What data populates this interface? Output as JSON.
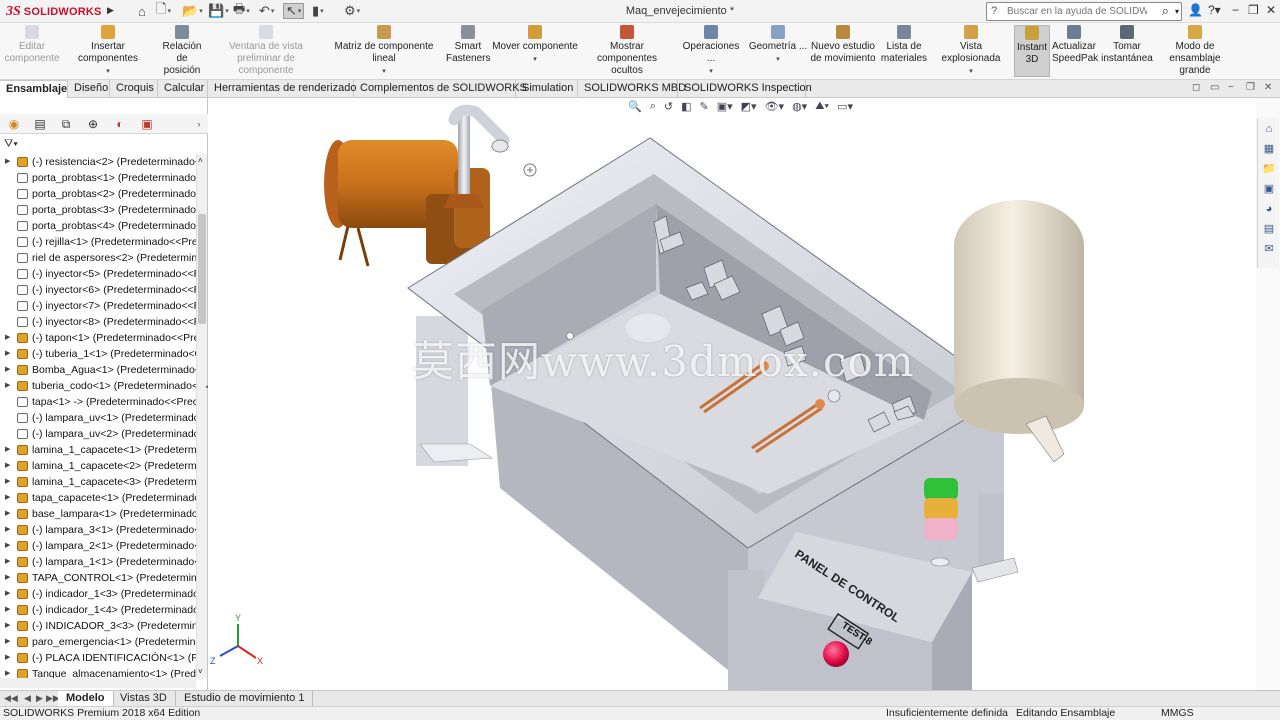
{
  "app": {
    "logo_ds": "3S",
    "logo_text": "SOLIDWORKS",
    "document_title": "Maq_envejecimiento *",
    "help_search_placeholder": "Buscar en la ayuda de SOLIDWORKS"
  },
  "quick_access": [
    "home-icon",
    "new-file-icon",
    "open-folder-icon",
    "save-icon",
    "print-icon",
    "undo-icon",
    "select-arrow-icon",
    "traffic-light-icon",
    "options-icon"
  ],
  "ribbon": [
    {
      "id": "editar",
      "label1": "Editar",
      "label2": "componente",
      "disabled": true
    },
    {
      "id": "insertar",
      "label1": "Insertar componentes",
      "label2": "",
      "disabled": false,
      "dropdown": true
    },
    {
      "id": "relacion",
      "label1": "Relación de",
      "label2": "posición",
      "disabled": false
    },
    {
      "id": "ventana",
      "label1": "Ventana de vista",
      "label2": "preliminar de componente",
      "disabled": true
    },
    {
      "id": "matriz",
      "label1": "Matriz de componente lineal",
      "label2": "",
      "disabled": false,
      "dropdown": true
    },
    {
      "id": "smart",
      "label1": "Smart",
      "label2": "Fasteners",
      "disabled": false
    },
    {
      "id": "mover",
      "label1": "Mover componente",
      "label2": "",
      "disabled": false,
      "dropdown": true
    },
    {
      "id": "mostrar",
      "label1": "Mostrar",
      "label2": "componentes ocultos",
      "disabled": false
    },
    {
      "id": "operaciones",
      "label1": "Operaciones ...",
      "label2": "",
      "disabled": false,
      "dropdown": true
    },
    {
      "id": "geometria",
      "label1": "Geometría ...",
      "label2": "",
      "disabled": false,
      "dropdown": true
    },
    {
      "id": "estudio",
      "label1": "Nuevo estudio",
      "label2": "de movimiento",
      "disabled": false
    },
    {
      "id": "lista",
      "label1": "Lista de",
      "label2": "materiales",
      "disabled": false
    },
    {
      "id": "explosionada",
      "label1": "Vista explosionada",
      "label2": "",
      "disabled": false,
      "dropdown": true
    },
    {
      "id": "instant3d",
      "label1": "Instant",
      "label2": "3D",
      "disabled": false,
      "active": true
    },
    {
      "id": "speedpak",
      "label1": "Actualizar",
      "label2": "SpeedPak",
      "disabled": false
    },
    {
      "id": "instantanea",
      "label1": "Tomar",
      "label2": "instantánea",
      "disabled": false
    },
    {
      "id": "grande",
      "label1": "Modo de",
      "label2": "ensamblaje grande",
      "disabled": false
    }
  ],
  "command_tabs": [
    "Ensamblaje",
    "Diseño",
    "Croquis",
    "Calcular",
    "Herramientas de renderizado",
    "Complementos de SOLIDWORKS",
    "Simulation",
    "SOLIDWORKS MBD",
    "SOLIDWORKS Inspection"
  ],
  "feature_tree": [
    {
      "label": "(-) resistencia<2> (Predeterminado<",
      "type": "asm",
      "expand": true
    },
    {
      "label": "porta_probtas<1> (Predeterminado-",
      "type": "part",
      "expand": false
    },
    {
      "label": "porta_probtas<2> (Predeterminado-",
      "type": "part",
      "expand": false
    },
    {
      "label": "porta_probtas<3> (Predeterminado-",
      "type": "part",
      "expand": false
    },
    {
      "label": "porta_probtas<4> (Predeterminado-",
      "type": "part",
      "expand": false
    },
    {
      "label": "(-) rejilla<1> (Predeterminado<<Pre",
      "type": "part",
      "expand": false
    },
    {
      "label": "riel de aspersores<2> (Predetermina",
      "type": "part",
      "expand": false
    },
    {
      "label": "(-) inyector<5> (Predeterminado<<P",
      "type": "part",
      "expand": false
    },
    {
      "label": "(-) inyector<6> (Predeterminado<<P",
      "type": "part",
      "expand": false
    },
    {
      "label": "(-) inyector<7> (Predeterminado<<P",
      "type": "part",
      "expand": false
    },
    {
      "label": "(-) inyector<8> (Predeterminado<<P",
      "type": "part",
      "expand": false
    },
    {
      "label": "(-) tapon<1> (Predeterminado<<Pre",
      "type": "asm",
      "expand": true
    },
    {
      "label": "(-) tuberia_1<1> (Predeterminado<C",
      "type": "asm",
      "expand": true
    },
    {
      "label": "Bomba_Agua<1> (Predeterminado<",
      "type": "asm",
      "expand": true
    },
    {
      "label": "tuberia_codo<1> (Predeterminado<",
      "type": "asm",
      "expand": true
    },
    {
      "label": "tapa<1> -> (Predeterminado<<Prec",
      "type": "part",
      "expand": false
    },
    {
      "label": "(-) lampara_uv<1> (Predeterminado",
      "type": "part",
      "expand": false
    },
    {
      "label": "(-) lampara_uv<2> (Predeterminado",
      "type": "part",
      "expand": false
    },
    {
      "label": "lamina_1_capacete<1> (Predetermin",
      "type": "asm",
      "expand": true
    },
    {
      "label": "lamina_1_capacete<2> (Predetermin",
      "type": "asm",
      "expand": true
    },
    {
      "label": "lamina_1_capacete<3> (Predetermin",
      "type": "asm",
      "expand": true
    },
    {
      "label": "tapa_capacete<1> (Predeterminado",
      "type": "asm",
      "expand": true
    },
    {
      "label": "base_lampara<1> (Predeterminado-",
      "type": "asm",
      "expand": true
    },
    {
      "label": "(-) lampara_3<1> (Predeterminado<",
      "type": "asm",
      "expand": true
    },
    {
      "label": "(-) lampara_2<1> (Predeterminado<",
      "type": "asm",
      "expand": true
    },
    {
      "label": "(-) lampara_1<1> (Predeterminado<",
      "type": "asm",
      "expand": true
    },
    {
      "label": "TAPA_CONTROL<1> (Predeterminad",
      "type": "asm",
      "expand": true
    },
    {
      "label": "(-) indicador_1<3> (Predeterminado",
      "type": "asm",
      "expand": true
    },
    {
      "label": "(-) indicador_1<4> (Predeterminado",
      "type": "asm",
      "expand": true
    },
    {
      "label": "(-) INDICADOR_3<3> (Predetermina",
      "type": "asm",
      "expand": true
    },
    {
      "label": "paro_emergencia<1> (Predetermina",
      "type": "asm",
      "expand": true
    },
    {
      "label": "(-) PLACA IDENTIFICACIÓN<1> (Prec",
      "type": "asm",
      "expand": true
    },
    {
      "label": "Tanque_almacenamiento<1> (Prede",
      "type": "asm",
      "expand": true
    }
  ],
  "bottom_tabs": [
    "Modelo",
    "Vistas 3D",
    "Estudio de movimiento 1"
  ],
  "status": {
    "edition": "SOLIDWORKS Premium 2018 x64 Edition",
    "definition": "Insuficientemente definida",
    "mode": "Editando Ensamblaje",
    "units": "MMGS"
  },
  "model": {
    "panel_label": "PANEL DE CONTROL",
    "panel_badge": "TEST-8",
    "axis_x": "X",
    "axis_y": "Y",
    "axis_z": "Z"
  },
  "watermark": "莫西网www.3dmox.com",
  "colors": {
    "brand_red": "#c8102e",
    "motor_orange": "#c8711b",
    "tank_cream": "#efe6d8",
    "steel_gray": "#c9cbd3",
    "emergency_red": "#e5104a",
    "light_green": "#2fc13a",
    "light_amber": "#e7b03a",
    "light_pink": "#f0b2c8"
  }
}
